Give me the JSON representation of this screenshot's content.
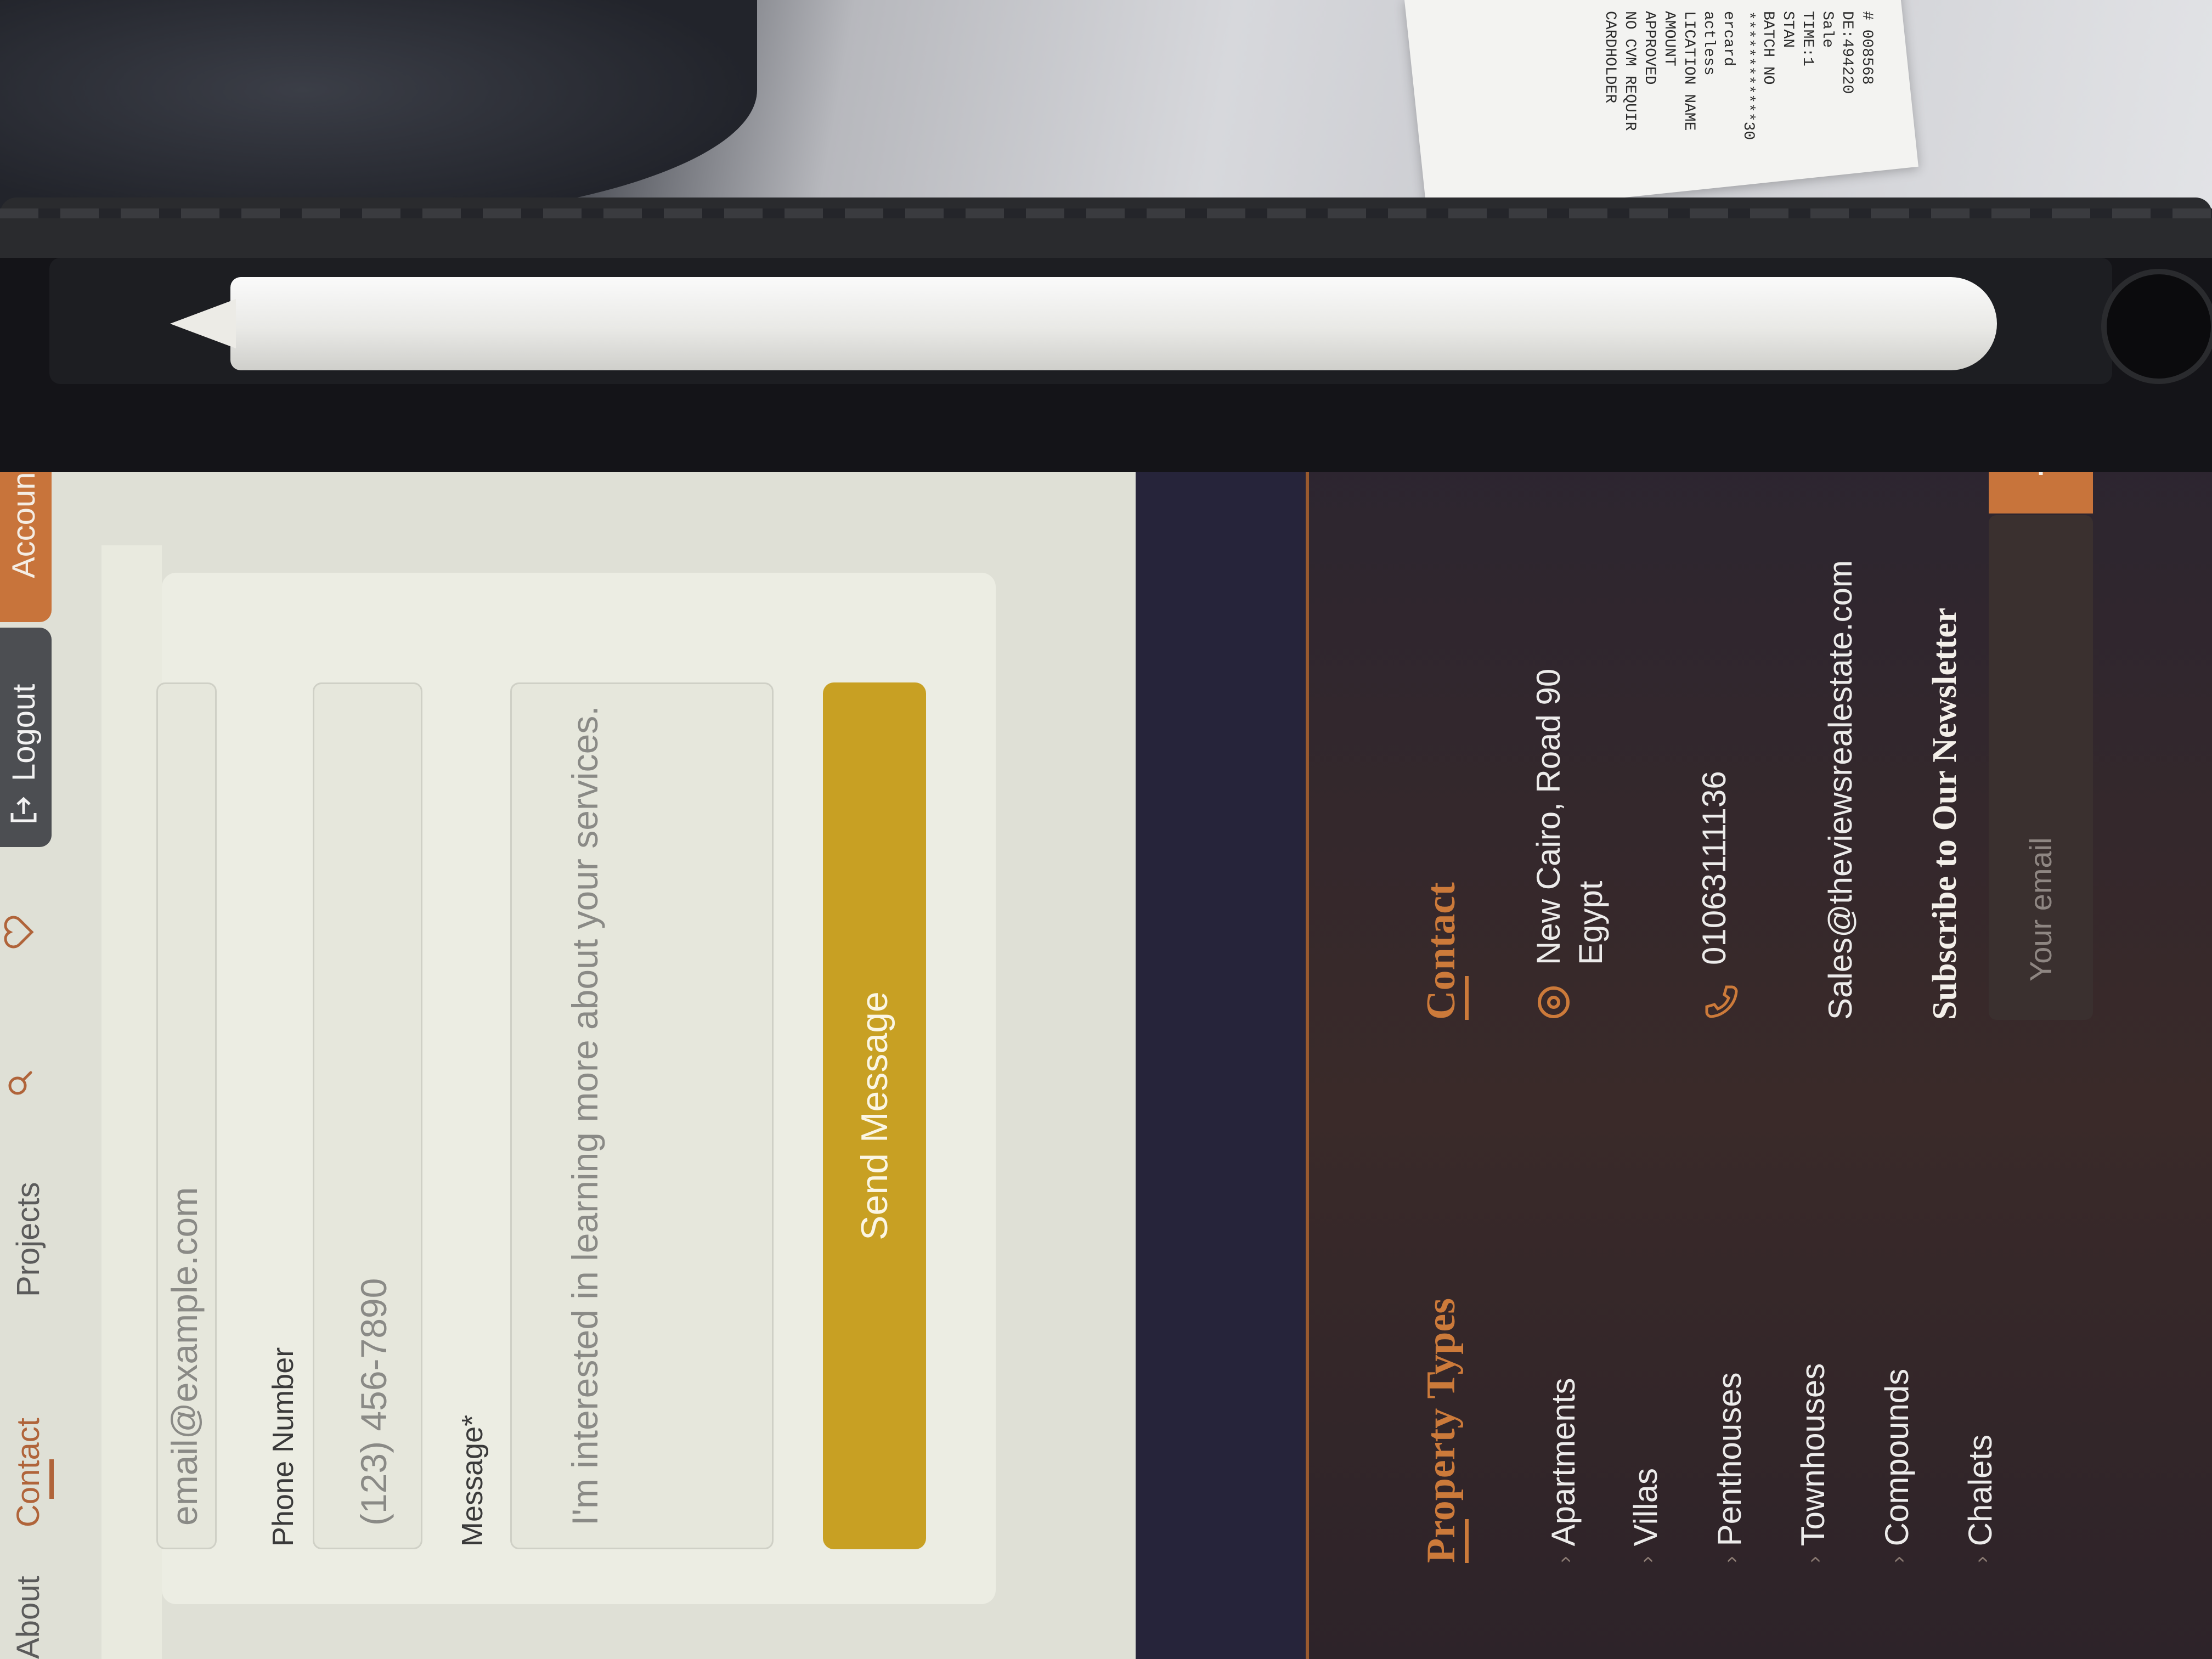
{
  "receipt": {
    "lines": [
      "# 008568",
      "DE:494220",
      "Sale",
      "TIME:1",
      "STAN",
      "BATCH NO",
      "************30",
      "ercard",
      "actless",
      "LICATION NAME",
      "AMOUNT",
      "APPROVED",
      "NO CVM REQUIR",
      "CARDHOLDER"
    ]
  },
  "header": {
    "nav": [
      "About",
      "Contact",
      "Projects"
    ],
    "logout_label": "Logout",
    "account_label": "Account"
  },
  "form": {
    "email_placeholder": "email@example.com",
    "phone_label": "Phone Number",
    "phone_placeholder": "(123) 456-7890",
    "message_label": "Message*",
    "message_placeholder": "I'm interested in learning more about your services.",
    "send_label": "Send Message"
  },
  "footer": {
    "property_types_heading": "Property Types",
    "property_types": [
      "Apartments",
      "Villas",
      "Penthouses",
      "Townhouses",
      "Compounds",
      "Chalets"
    ],
    "contact_heading": "Contact",
    "address_line1": "New Cairo, Road 90",
    "address_line2": "Egypt",
    "phone": "01063111136",
    "email": "Sales@theviewsrealestate.com",
    "newsletter_heading": "Subscribe to Our Newsletter",
    "newsletter_placeholder": "Your email"
  },
  "colors": {
    "accent": "#cc7a3a",
    "send_button": "#c8a023",
    "footer_bg": "#2d2329"
  }
}
